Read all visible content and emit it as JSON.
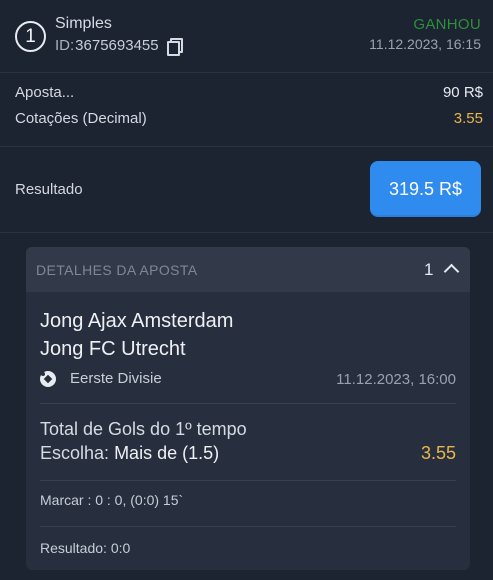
{
  "header": {
    "number": "1",
    "type": "Simples",
    "id_prefix": "ID:",
    "id": "3675693455",
    "status": "GANHOU",
    "datetime": "11.12.2023, 16:15"
  },
  "summary": {
    "stake_label": "Aposta...",
    "stake_value": "90 R$",
    "odds_label": "Cotações (Decimal)",
    "odds_value": "3.55",
    "result_label": "Resultado",
    "result_value": "319.5 R$"
  },
  "details": {
    "title": "DETALHES DA APOSTA",
    "count": "1",
    "team_home": "Jong Ajax Amsterdam",
    "team_away": "Jong FC Utrecht",
    "league": "Eerste Divisie",
    "match_datetime": "11.12.2023, 16:00",
    "market": "Total de Gols do 1º tempo",
    "pick_label": "Escolha:",
    "pick_value": "Mais de (1.5)",
    "pick_odds": "3.55",
    "score": "Marcar : 0 : 0, (0:0) 15`",
    "final_result": "Resultado: 0:0"
  },
  "colors": {
    "background": "#1c2331",
    "status_won": "#2f8f3a",
    "odds": "#e9b64c",
    "primary_button": "#2f8bed"
  },
  "icons": [
    "copy-icon",
    "soccer-ball-icon",
    "chevron-up-icon"
  ]
}
